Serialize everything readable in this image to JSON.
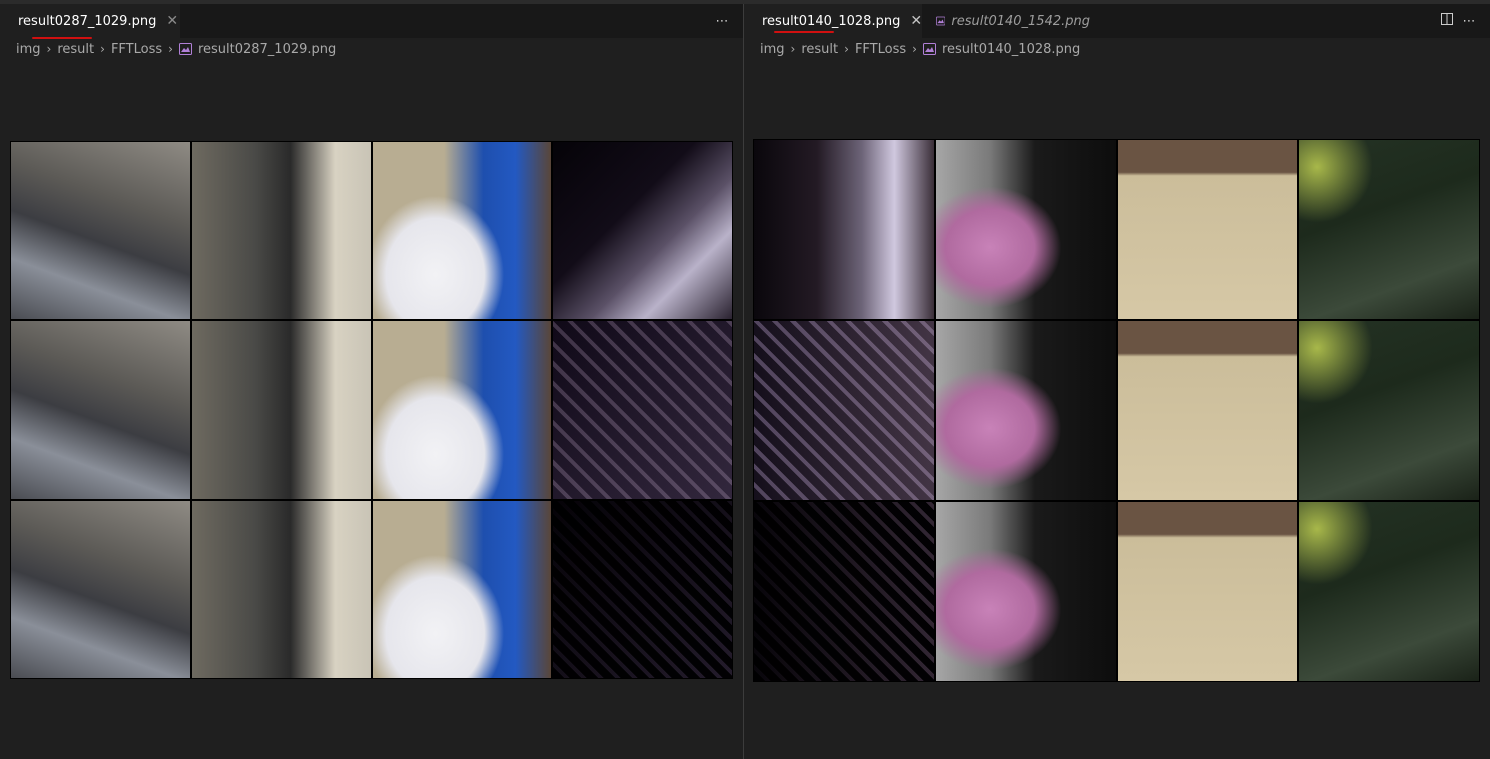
{
  "left": {
    "tabs": [
      {
        "label": "result0287_1029.png",
        "icon": "image-file-icon",
        "close": "✕"
      }
    ],
    "more_icon": "⋯",
    "breadcrumb": [
      "img",
      "result",
      "FFTLoss",
      "result0287_1029.png"
    ]
  },
  "right": {
    "tabs": [
      {
        "label": "result0140_1028.png",
        "icon": "image-file-icon",
        "close": "✕"
      },
      {
        "label": "result0140_1542.png",
        "icon": "image-file-icon"
      }
    ],
    "split_icon": "▯",
    "more_icon": "⋯",
    "breadcrumb": [
      "img",
      "result",
      "FFTLoss",
      "result0140_1028.png"
    ]
  },
  "colors": {
    "accent_underline": "#d01010",
    "file_icon": "#b180d7"
  }
}
